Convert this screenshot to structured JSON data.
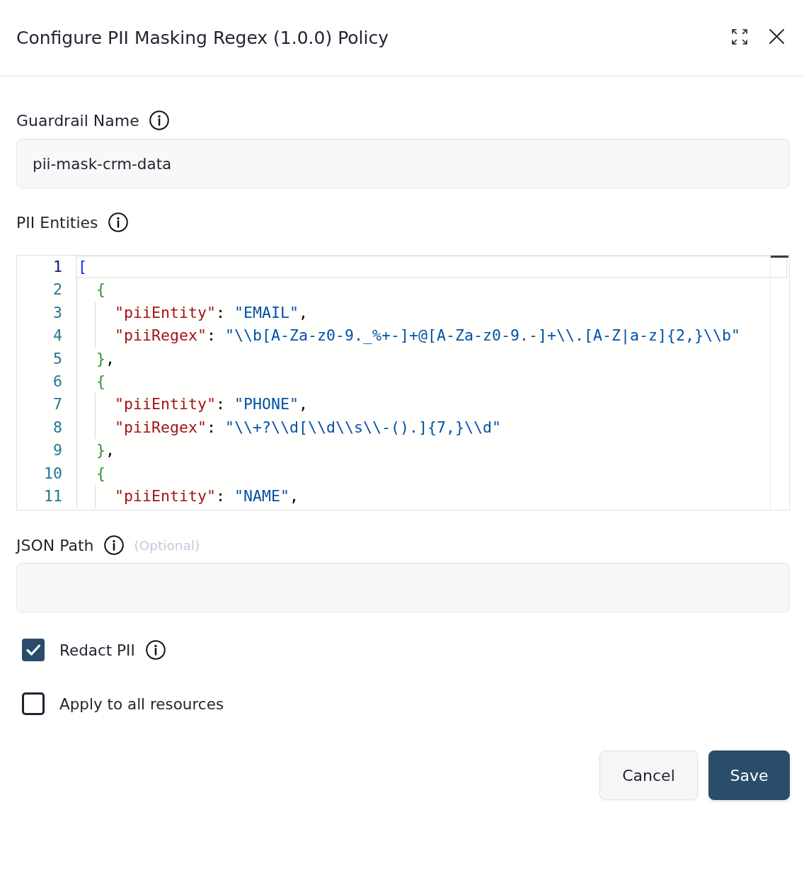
{
  "dialog": {
    "title": "Configure PII Masking Regex (1.0.0) Policy"
  },
  "guardrail_name": {
    "label": "Guardrail Name",
    "info": true,
    "value": "pii-mask-crm-data"
  },
  "pii_entities": {
    "label": "PII Entities",
    "info": true,
    "lines": [
      {
        "number": "1",
        "active": true,
        "tokens": [
          {
            "kind": "open",
            "text": "["
          }
        ]
      },
      {
        "number": "2",
        "active": false,
        "tokens": [
          {
            "kind": "open",
            "text": "{"
          }
        ]
      },
      {
        "number": "3",
        "active": false,
        "tokens": [
          {
            "kind": "key",
            "text": "\"piiEntity\""
          },
          {
            "kind": "punct",
            "text": ": "
          },
          {
            "kind": "string",
            "text": "\"EMAIL\""
          },
          {
            "kind": "punct",
            "text": ","
          }
        ]
      },
      {
        "number": "4",
        "active": false,
        "tokens": [
          {
            "kind": "key",
            "text": "\"piiRegex\""
          },
          {
            "kind": "punct",
            "text": ": "
          },
          {
            "kind": "string",
            "text": "\"\\\\b[A-Za-z0-9._%+-]+@[A-Za-z0-9.-]+\\\\.[A-Z|a-z]{2,}\\\\b\""
          }
        ]
      },
      {
        "number": "5",
        "active": false,
        "tokens": [
          {
            "kind": "close",
            "text": "}"
          },
          {
            "kind": "punct",
            "text": ","
          }
        ]
      },
      {
        "number": "6",
        "active": false,
        "tokens": [
          {
            "kind": "open",
            "text": "{"
          }
        ]
      },
      {
        "number": "7",
        "active": false,
        "tokens": [
          {
            "kind": "key",
            "text": "\"piiEntity\""
          },
          {
            "kind": "punct",
            "text": ": "
          },
          {
            "kind": "string",
            "text": "\"PHONE\""
          },
          {
            "kind": "punct",
            "text": ","
          }
        ]
      },
      {
        "number": "8",
        "active": false,
        "tokens": [
          {
            "kind": "key",
            "text": "\"piiRegex\""
          },
          {
            "kind": "punct",
            "text": ": "
          },
          {
            "kind": "string",
            "text": "\"\\\\+?\\\\d[\\\\d\\\\s\\\\-().]{7,}\\\\d\""
          }
        ]
      },
      {
        "number": "9",
        "active": false,
        "tokens": [
          {
            "kind": "close",
            "text": "}"
          },
          {
            "kind": "punct",
            "text": ","
          }
        ]
      },
      {
        "number": "10",
        "active": false,
        "tokens": [
          {
            "kind": "open",
            "text": "{"
          }
        ]
      },
      {
        "number": "11",
        "active": false,
        "tokens": [
          {
            "kind": "key",
            "text": "\"piiEntity\""
          },
          {
            "kind": "punct",
            "text": ": "
          },
          {
            "kind": "string",
            "text": "\"NAME\""
          },
          {
            "kind": "punct",
            "text": ","
          }
        ]
      }
    ]
  },
  "json_path": {
    "label": "JSON Path",
    "info": true,
    "hint": "(Optional)"
  },
  "checkboxes": [
    {
      "label": "Redact PII",
      "checked": true,
      "info": true
    },
    {
      "label": "Apply to all resources",
      "checked": false,
      "info": false
    }
  ],
  "buttons": [
    {
      "label": "Cancel",
      "kind": "secondary"
    },
    {
      "label": "Save",
      "kind": "primary"
    }
  ]
}
